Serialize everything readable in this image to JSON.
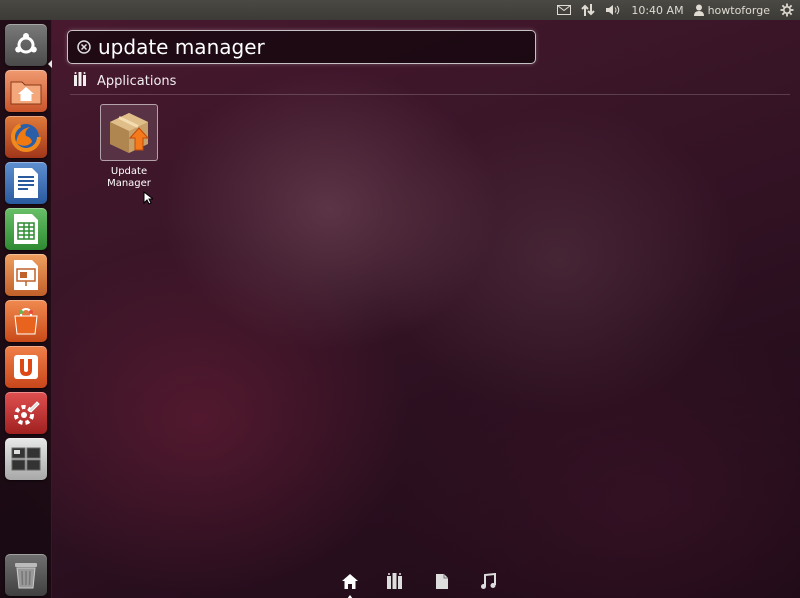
{
  "top_panel": {
    "clock": "10:40 AM",
    "user_name": "howtoforge",
    "icons": [
      "mail-icon",
      "network-icon",
      "volume-icon",
      "user-icon",
      "session-gear-icon"
    ]
  },
  "launcher": {
    "items": [
      {
        "name": "dash-home",
        "icon": "ubuntu-logo-icon"
      },
      {
        "name": "home-folder",
        "icon": "home-folder-icon"
      },
      {
        "name": "firefox",
        "icon": "firefox-icon"
      },
      {
        "name": "libreoffice-writer",
        "icon": "writer-icon"
      },
      {
        "name": "libreoffice-calc",
        "icon": "calc-icon"
      },
      {
        "name": "libreoffice-impress",
        "icon": "impress-icon"
      },
      {
        "name": "software-center",
        "icon": "software-center-icon"
      },
      {
        "name": "ubuntu-one",
        "icon": "ubuntu-one-icon"
      },
      {
        "name": "system-settings",
        "icon": "settings-icon"
      },
      {
        "name": "workspace-switcher",
        "icon": "workspace-icon"
      },
      {
        "name": "trash",
        "icon": "trash-icon"
      }
    ]
  },
  "dash": {
    "search_query": "update manager",
    "category_title": "Applications",
    "results": [
      {
        "label_line1": "Update",
        "label_line2": "Manager",
        "icon": "update-manager-icon"
      }
    ]
  },
  "lens_bar": {
    "lenses": [
      "home-lens-icon",
      "applications-lens-icon",
      "files-lens-icon",
      "music-lens-icon"
    ],
    "active": "home-lens-icon"
  },
  "colors": {
    "panel": "#3c3b37",
    "accent_orange": "#dd4814"
  }
}
